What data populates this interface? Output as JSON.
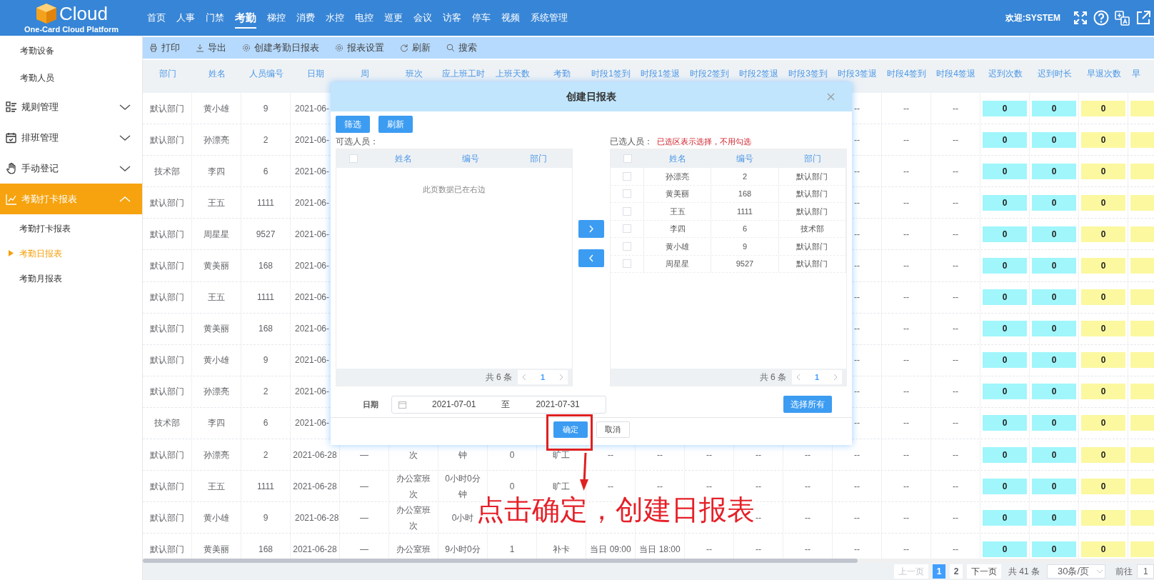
{
  "brand": {
    "name": "Cloud",
    "subtitle": "One-Card Cloud Platform"
  },
  "nav": [
    {
      "label": "首页",
      "selected": false
    },
    {
      "label": "人事",
      "selected": false
    },
    {
      "label": "门禁",
      "selected": false
    },
    {
      "label": "考勤",
      "selected": true
    },
    {
      "label": "梯控",
      "selected": false
    },
    {
      "label": "消费",
      "selected": false
    },
    {
      "label": "水控",
      "selected": false
    },
    {
      "label": "电控",
      "selected": false
    },
    {
      "label": "巡更",
      "selected": false
    },
    {
      "label": "会议",
      "selected": false
    },
    {
      "label": "访客",
      "selected": false
    },
    {
      "label": "停车",
      "selected": false
    },
    {
      "label": "视频",
      "selected": false
    },
    {
      "label": "系统管理",
      "selected": false
    }
  ],
  "welcome": "欢迎:SYSTEM",
  "sidebar": {
    "items": [
      {
        "label": "考勤设备",
        "kind": "leaf",
        "selected": false
      },
      {
        "label": "考勤人员",
        "kind": "leaf",
        "selected": false
      },
      {
        "label": "规则管理",
        "kind": "group",
        "expanded": false,
        "selected": false
      },
      {
        "label": "排班管理",
        "kind": "group",
        "expanded": false,
        "selected": false
      },
      {
        "label": "手动登记",
        "kind": "group",
        "expanded": false,
        "selected": false
      },
      {
        "label": "考勤打卡报表",
        "kind": "group",
        "expanded": true,
        "selected": true,
        "children": [
          {
            "label": "考勤打卡报表",
            "selected": false
          },
          {
            "label": "考勤日报表",
            "selected": true
          },
          {
            "label": "考勤月报表",
            "selected": false
          }
        ]
      }
    ]
  },
  "toolbar": [
    "打印",
    "导出",
    "创建考勤日报表",
    "报表设置",
    "刷新",
    "搜索"
  ],
  "table": {
    "columns": [
      {
        "label": "部门"
      },
      {
        "label": "姓名"
      },
      {
        "label": "人员编号"
      },
      {
        "label": "日期"
      },
      {
        "label": "周"
      },
      {
        "label": "班次"
      },
      {
        "label": "应上班工时"
      },
      {
        "label": "上班天数"
      },
      {
        "label": "考勤"
      },
      {
        "label": "时段1签到"
      },
      {
        "label": "时段1签退"
      },
      {
        "label": "时段2签到"
      },
      {
        "label": "时段2签退"
      },
      {
        "label": "时段3签到"
      },
      {
        "label": "时段3签退"
      },
      {
        "label": "时段4签到"
      },
      {
        "label": "时段4签退"
      },
      {
        "label": "迟到次数",
        "color": "#a0f6fb"
      },
      {
        "label": "迟到时长",
        "color": "#a0f6fb"
      },
      {
        "label": "早退次数",
        "color": "#fbf8a0"
      },
      {
        "label": "早",
        "color": "#fbf8a0"
      }
    ],
    "rows": [
      {
        "visible_start": [
          "默认部门",
          "黄小雄",
          "9",
          "2021-06-"
        ],
        "visible_end": [
          "--",
          "--",
          "--",
          "0",
          "0",
          "0"
        ]
      },
      {
        "visible_start": [
          "默认部门",
          "孙漂亮",
          "2",
          "2021-06-"
        ],
        "visible_end": [
          "--",
          "--",
          "--",
          "0",
          "0",
          "0"
        ]
      },
      {
        "visible_start": [
          "技术部",
          "李四",
          "6",
          "2021-06-"
        ],
        "visible_end": [
          "--",
          "--",
          "--",
          "0",
          "0",
          "0"
        ]
      },
      {
        "visible_start": [
          "默认部门",
          "王五",
          "1111",
          "2021-06-"
        ],
        "visible_end": [
          "--",
          "--",
          "--",
          "0",
          "0",
          "0"
        ]
      },
      {
        "visible_start": [
          "默认部门",
          "周星星",
          "9527",
          "2021-06-"
        ],
        "visible_end": [
          "--",
          "--",
          "--",
          "0",
          "0",
          "0"
        ]
      },
      {
        "visible_start": [
          "默认部门",
          "黄美丽",
          "168",
          "2021-06-"
        ],
        "visible_end": [
          "--",
          "--",
          "--",
          "0",
          "0",
          "0"
        ]
      },
      {
        "visible_start": [
          "默认部门",
          "王五",
          "1111",
          "2021-06-"
        ],
        "visible_end": [
          "--",
          "--",
          "--",
          "0",
          "0",
          "0"
        ]
      },
      {
        "visible_start": [
          "默认部门",
          "黄美丽",
          "168",
          "2021-06-"
        ],
        "visible_end": [
          "--",
          "--",
          "--",
          "0",
          "0",
          "0"
        ]
      },
      {
        "visible_start": [
          "默认部门",
          "黄小雄",
          "9",
          "2021-06-"
        ],
        "visible_end": [
          "--",
          "--",
          "--",
          "0",
          "0",
          "0"
        ]
      },
      {
        "visible_start": [
          "默认部门",
          "孙漂亮",
          "2",
          "2021-06-"
        ],
        "visible_end": [
          "--",
          "--",
          "--",
          "0",
          "0",
          "0"
        ]
      },
      {
        "visible_start": [
          "技术部",
          "李四",
          "6",
          "2021-06-"
        ],
        "visible_end": [
          "--",
          "--",
          "--",
          "0",
          "0",
          "0"
        ]
      },
      {
        "cells": [
          "默认部门",
          "孙漂亮",
          "2",
          "2021-06-28",
          "—",
          "次",
          "钟",
          "0",
          "旷工",
          "--",
          "--",
          "--",
          "--",
          "--",
          "--",
          "--",
          "--",
          "0",
          "0",
          "0"
        ]
      },
      {
        "cells": [
          "默认部门",
          "王五",
          "1111",
          "2021-06-28",
          "—",
          "办公室班次",
          "0小时0分钟",
          "0",
          "旷工",
          "--",
          "--",
          "--",
          "--",
          "--",
          "--",
          "--",
          "--",
          "0",
          "0",
          "0"
        ]
      },
      {
        "visible_start": [
          "默认部门",
          "黄小雄",
          "9",
          "2021-06-28",
          "—",
          "办公室班次",
          "0小时"
        ],
        "visible_end": [
          "--",
          "--",
          "--",
          "--",
          "--",
          "0",
          "0",
          "0"
        ]
      },
      {
        "cells": [
          "默认部门",
          "黄美丽",
          "168",
          "2021-06-28",
          "—",
          "办公室班",
          "9小时0分",
          "1",
          "补卡",
          "当日 09:00",
          "当日 18:00",
          "--",
          "--",
          "--",
          "--",
          "--",
          "--",
          "0",
          "0",
          "0"
        ]
      }
    ]
  },
  "pagination": {
    "prev": "上一页",
    "pages": [
      {
        "label": "1",
        "selected": true
      },
      {
        "label": "2",
        "selected": false
      }
    ],
    "next": "下一页",
    "total": "共 41 条",
    "page_size": "30条/页",
    "goto": "前往",
    "goto_value": "1"
  },
  "dialog": {
    "title": "创建日报表",
    "buttons": [
      "筛选",
      "刷新"
    ],
    "available": {
      "label": "可选人员：",
      "all_checked": false,
      "columns": [
        "姓名",
        "编号",
        "部门"
      ],
      "empty": "此页数据已在右边",
      "total": "共 6 条",
      "page": "1"
    },
    "chosen": {
      "label": "已选人员：",
      "note": "已选区表示选择，不用勾选",
      "all_checked": false,
      "columns": [
        "姓名",
        "编号",
        "部门"
      ],
      "total": "共 6 条",
      "page": "1",
      "rows": [
        {
          "cells": [
            "孙漂亮",
            "2",
            "默认部门"
          ],
          "checked": false
        },
        {
          "cells": [
            "黄美丽",
            "168",
            "默认部门"
          ],
          "checked": false
        },
        {
          "cells": [
            "王五",
            "1111",
            "默认部门"
          ],
          "checked": false
        },
        {
          "cells": [
            "李四",
            "6",
            "技术部"
          ],
          "checked": false
        },
        {
          "cells": [
            "黄小雄",
            "9",
            "默认部门"
          ],
          "checked": false
        },
        {
          "cells": [
            "周星星",
            "9527",
            "默认部门"
          ],
          "checked": false
        }
      ]
    },
    "date": {
      "label": "日期",
      "start": "2021-07-01",
      "separator": "至",
      "end": "2021-07-31"
    },
    "select_all": "选择所有",
    "confirm": "确定",
    "cancel": "取消"
  },
  "annotation": {
    "text": "点击确定，创建日报表"
  }
}
